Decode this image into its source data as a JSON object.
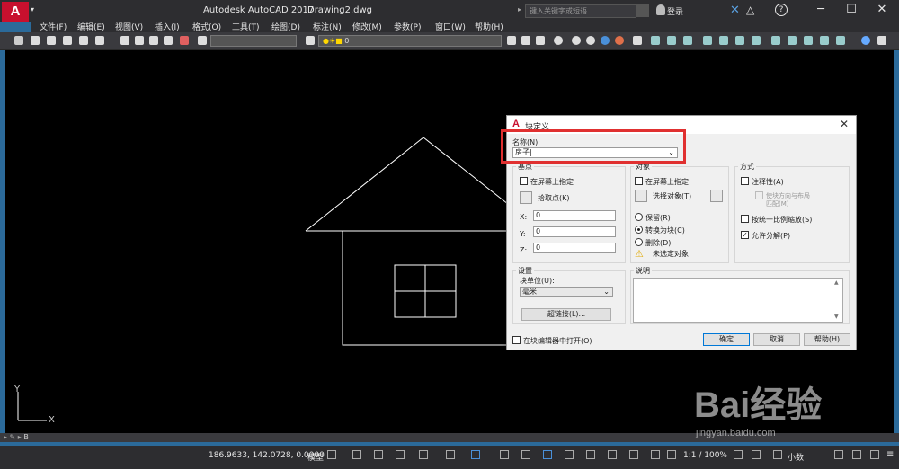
{
  "window": {
    "app_title": "Autodesk AutoCAD 2017",
    "doc_title": "Drawing2.dwg",
    "search_placeholder": "键入关键字或短语",
    "login_label": "登录",
    "help_label": "?"
  },
  "menu": [
    "文件(F)",
    "编辑(E)",
    "视图(V)",
    "插入(I)",
    "格式(O)",
    "工具(T)",
    "绘图(D)",
    "标注(N)",
    "修改(M)",
    "参数(P)",
    "窗口(W)",
    "帮助(H)"
  ],
  "toolbar": {
    "layer_value": "0"
  },
  "dialog": {
    "title": "块定义",
    "name_label": "名称(N):",
    "name_value": "房子|",
    "basepoint": {
      "title": "基点",
      "on_screen": "在屏幕上指定",
      "pick_label": "拾取点(K)",
      "x_label": "X:",
      "x_value": "0",
      "y_label": "Y:",
      "y_value": "0",
      "z_label": "Z:",
      "z_value": "0"
    },
    "objects": {
      "title": "对象",
      "on_screen": "在屏幕上指定",
      "select_label": "选择对象(T)",
      "retain": "保留(R)",
      "convert": "转换为块(C)",
      "delete": "删除(D)",
      "none_selected": "未选定对象"
    },
    "behavior": {
      "title": "方式",
      "annotative": "注释性(A)",
      "match_orient_1": "使块方向与布局",
      "match_orient_2": "匹配(M)",
      "uniform_scale": "按统一比例缩放(S)",
      "allow_explode": "允许分解(P)"
    },
    "settings": {
      "title": "设置",
      "unit_label": "块单位(U):",
      "unit_value": "毫米",
      "hyperlink": "超链接(L)..."
    },
    "description": {
      "title": "说明"
    },
    "open_in_editor": "在块编辑器中打开(O)",
    "ok": "确定",
    "cancel": "取消",
    "help": "帮助(H)"
  },
  "status": {
    "coords": "186.9633, 142.0728, 0.0000",
    "model": "模型",
    "scale": "1:1 / 100%",
    "units": "小数"
  },
  "cmdline": "B",
  "ucs": {
    "x": "X",
    "y": "Y"
  },
  "watermark": {
    "main": "Bai经验",
    "sub": "jingyan.baidu.com"
  }
}
